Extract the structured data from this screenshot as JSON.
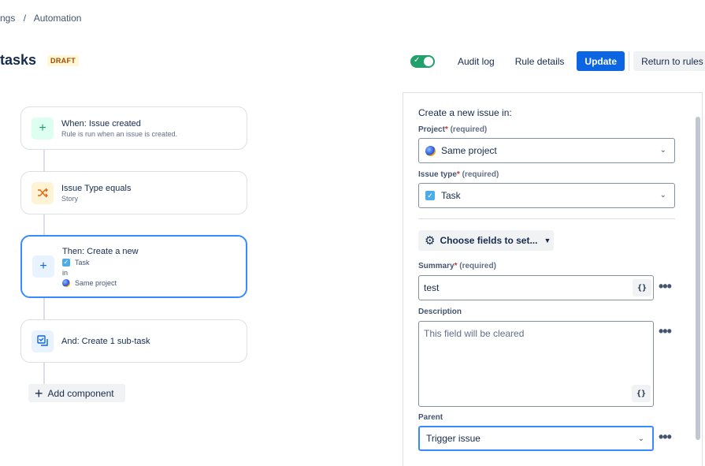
{
  "breadcrumb": {
    "items": [
      "ngs",
      "/",
      "Automation"
    ]
  },
  "header": {
    "title": "tasks",
    "badge": "DRAFT"
  },
  "toolbar": {
    "toggle_enabled": true,
    "audit_log": "Audit log",
    "rule_details": "Rule details",
    "update": "Update",
    "return": "Return to rules"
  },
  "flow": {
    "trigger": {
      "title": "When: Issue created",
      "subtitle": "Rule is run when an issue is created.",
      "icon": "plus-icon",
      "color": "#22a06b"
    },
    "condition": {
      "title": "Issue Type equals",
      "subtitle": "Story",
      "icon": "shuffle-icon",
      "color": "#e56910"
    },
    "action": {
      "title": "Then: Create a new",
      "issue_type": "Task",
      "in": "in",
      "project": "Same project",
      "icon": "plus-icon",
      "color": "#0c66e4"
    },
    "subtask": {
      "title": "And: Create 1 sub-task",
      "icon": "subtask-icon",
      "color": "#0c66e4"
    },
    "add_component": "Add component"
  },
  "panel": {
    "intro": "Create a new issue in:",
    "project": {
      "label": "Project",
      "required_mark": "*",
      "required_text": "(required)",
      "value": "Same project"
    },
    "issue_type": {
      "label": "Issue type",
      "required_mark": "*",
      "required_text": "(required)",
      "value": "Task"
    },
    "choose_fields": "Choose fields to set...",
    "summary": {
      "label": "Summary",
      "required_mark": "*",
      "required_text": "(required)",
      "value": "test",
      "smart_value": "{}"
    },
    "description": {
      "label": "Description",
      "value": "This field will be cleared",
      "smart_value": "{}"
    },
    "parent": {
      "label": "Parent",
      "value": "Trigger issue"
    },
    "more": "•••"
  }
}
